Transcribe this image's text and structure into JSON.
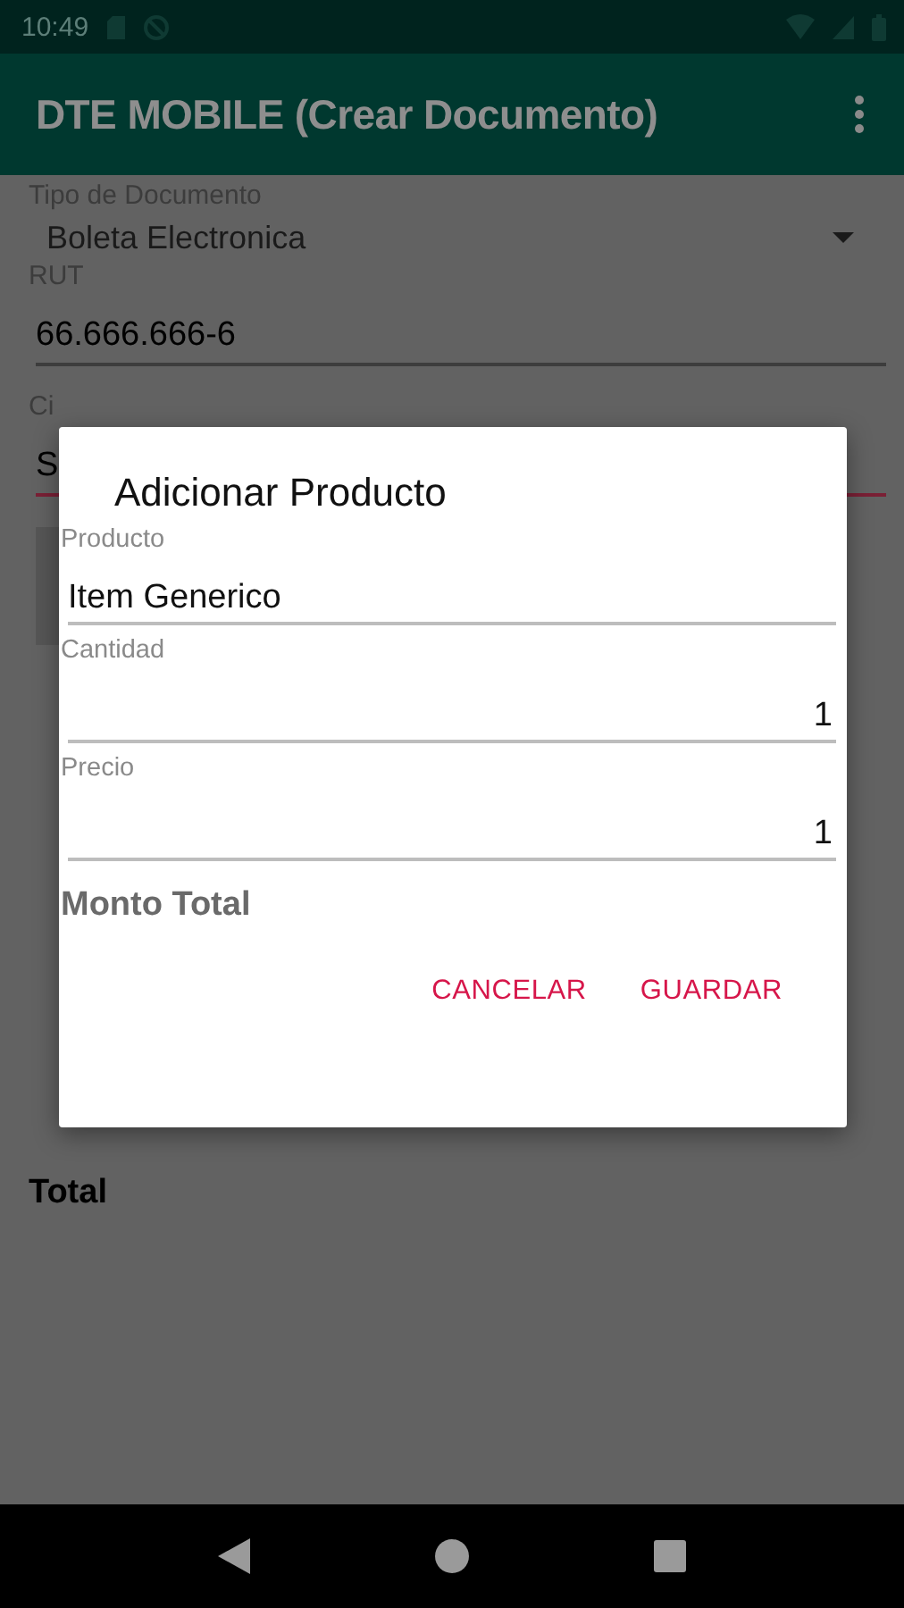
{
  "status_bar": {
    "time": "10:49"
  },
  "app_bar": {
    "title": "DTE MOBILE (Crear Documento)"
  },
  "form": {
    "document_type": {
      "label": "Tipo de Documento",
      "value": "Boleta Electronica"
    },
    "rut": {
      "label": "RUT",
      "value": "66.666.666-6",
      "focused": false
    },
    "field_3": {
      "label": "Ci",
      "value": "S",
      "focused": true
    },
    "total_label": "Total"
  },
  "dialog": {
    "title": "Adicionar Producto",
    "fields": [
      {
        "label": "Producto",
        "value": "Item Generico",
        "kind": "text"
      },
      {
        "label": "Cantidad",
        "value": "1",
        "kind": "number"
      },
      {
        "label": "Precio",
        "value": "1",
        "kind": "number"
      }
    ],
    "total_label": "Monto Total",
    "buttons": [
      "CANCELAR",
      "GUARDAR"
    ]
  }
}
